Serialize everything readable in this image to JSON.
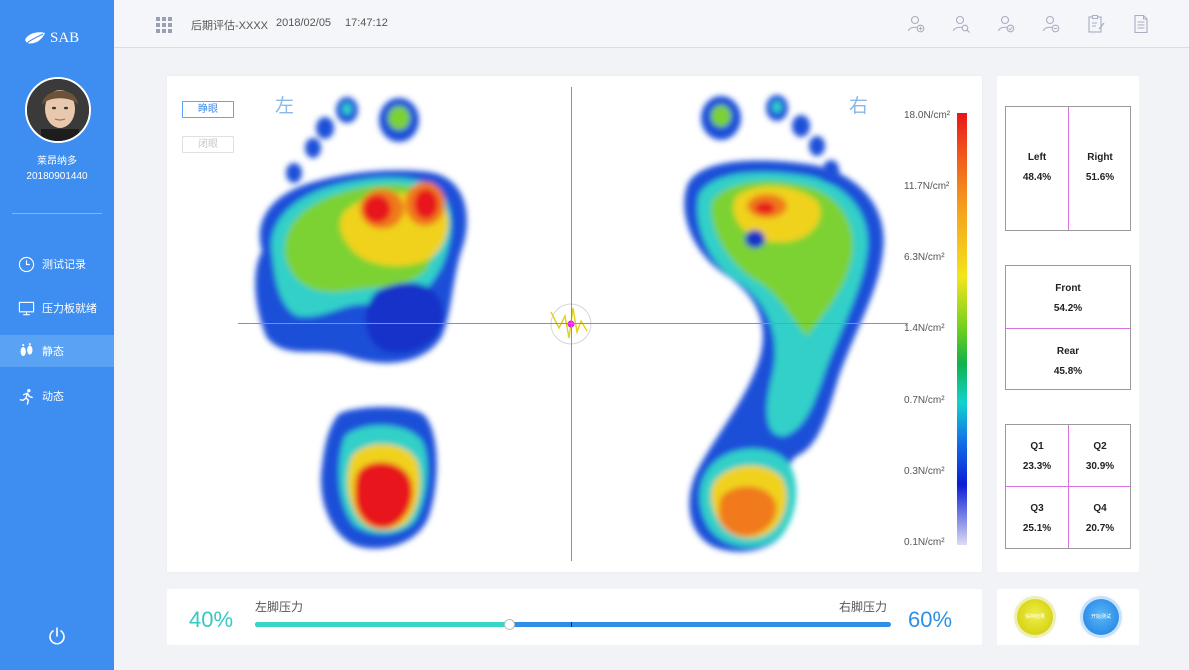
{
  "brand": {
    "name": "SAB"
  },
  "user": {
    "name": "莱昂纳多",
    "id": "20180901440"
  },
  "nav": [
    {
      "label": "测试记录",
      "icon": "clock-icon"
    },
    {
      "label": "压力板就绪",
      "icon": "monitor-icon"
    },
    {
      "label": "静态",
      "icon": "footprint-icon",
      "active": true
    },
    {
      "label": "动态",
      "icon": "running-icon"
    }
  ],
  "header": {
    "title": "后期评估-XXXX",
    "date": "2018/02/05",
    "time": "17:47:12"
  },
  "toolbar": [
    "user-add-icon",
    "user-search-icon",
    "user-check-icon",
    "user-edit-icon",
    "clipboard-edit-icon",
    "document-icon"
  ],
  "view": {
    "tab_open": "睁眼",
    "tab_closed": "闭眼",
    "left_label": "左",
    "right_label": "右"
  },
  "scale": {
    "labels": [
      "18.0N/cm²",
      "11.7N/cm²",
      "6.3N/cm²",
      "1.4N/cm²",
      "0.7N/cm²",
      "0.3N/cm²",
      "0.1N/cm²"
    ]
  },
  "stats": {
    "left": {
      "label": "Left",
      "value": "48.4%"
    },
    "right": {
      "label": "Right",
      "value": "51.6%"
    },
    "front": {
      "label": "Front",
      "value": "54.2%"
    },
    "rear": {
      "label": "Rear",
      "value": "45.8%"
    },
    "q1": {
      "label": "Q1",
      "value": "23.3%"
    },
    "q2": {
      "label": "Q2",
      "value": "30.9%"
    },
    "q3": {
      "label": "Q3",
      "value": "25.1%"
    },
    "q4": {
      "label": "Q4",
      "value": "20.7%"
    }
  },
  "balance": {
    "left_pct": "40%",
    "right_pct": "60%",
    "left_label": "左脚压力",
    "right_label": "右脚压力",
    "left_fraction": 0.4
  },
  "actions": {
    "yellow_label": "保存结果",
    "blue_label": "开始测试"
  },
  "colors": {
    "sidebar": "#3d8ef0",
    "accent_teal": "#38c7c1",
    "accent_blue": "#2f8fe6",
    "crosshair": "#d95de0"
  }
}
